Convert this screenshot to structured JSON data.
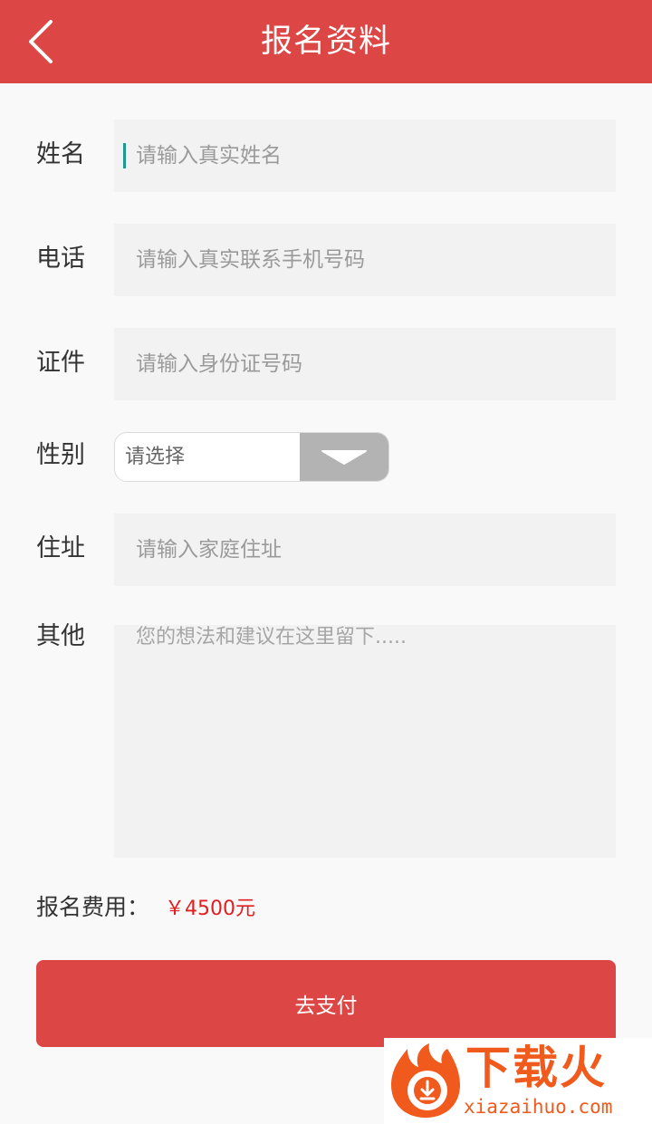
{
  "header": {
    "title": "报名资料",
    "back_icon": "chevron-left-icon"
  },
  "form": {
    "name": {
      "label": "姓名",
      "placeholder": "请输入真实姓名"
    },
    "phone": {
      "label": "电话",
      "placeholder": "请输入真实联系手机号码"
    },
    "id_card": {
      "label": "证件",
      "placeholder": "请输入身份证号码"
    },
    "gender": {
      "label": "性别",
      "selected": "请选择"
    },
    "address": {
      "label": "住址",
      "placeholder": "请输入家庭住址"
    },
    "other": {
      "label": "其他",
      "placeholder": "您的想法和建议在这里留下....."
    }
  },
  "fee": {
    "label": "报名费用：",
    "value": "￥4500元"
  },
  "pay_button": {
    "label": "去支付"
  },
  "watermark": {
    "brand_cn": "下载火",
    "brand_en": "xiazaihuo.com"
  },
  "colors": {
    "primary": "#dc4645",
    "fee_red": "#e02020",
    "input_bg": "#f2f2f2",
    "page_bg": "#f9f9f9",
    "cursor": "#1e9a8c"
  }
}
